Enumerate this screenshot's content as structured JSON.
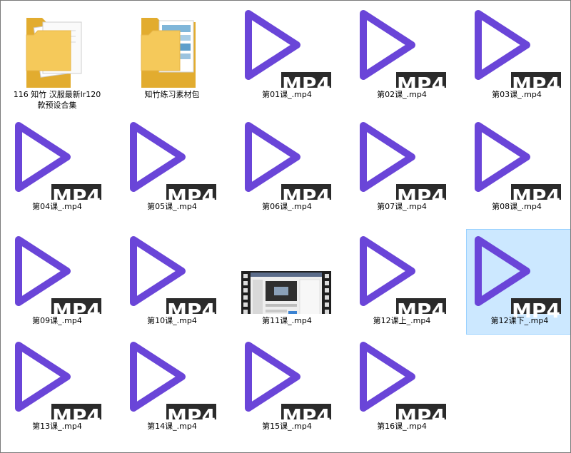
{
  "explorer": {
    "items": [
      {
        "label": "116  知竹 汉服最新lr120\n款预设合集",
        "kind": "folder",
        "icon": "folder-with-documents-icon",
        "selected": false
      },
      {
        "label": "知竹练习素材包",
        "kind": "folder",
        "icon": "folder-with-images-icon",
        "selected": false
      },
      {
        "label": "第01课_.mp4",
        "kind": "video",
        "icon": "mp4-play-icon",
        "badge": "MP4",
        "selected": false
      },
      {
        "label": "第02课_.mp4",
        "kind": "video",
        "icon": "mp4-play-icon",
        "badge": "MP4",
        "selected": false
      },
      {
        "label": "第03课_.mp4",
        "kind": "video",
        "icon": "mp4-play-icon",
        "badge": "MP4",
        "selected": false
      },
      {
        "label": "第04课_.mp4",
        "kind": "video",
        "icon": "mp4-play-icon",
        "badge": "MP4",
        "selected": false
      },
      {
        "label": "第05课_.mp4",
        "kind": "video",
        "icon": "mp4-play-icon",
        "badge": "MP4",
        "selected": false
      },
      {
        "label": "第06课_.mp4",
        "kind": "video",
        "icon": "mp4-play-icon",
        "badge": "MP4",
        "selected": false
      },
      {
        "label": "第07课_.mp4",
        "kind": "video",
        "icon": "mp4-play-icon",
        "badge": "MP4",
        "selected": false
      },
      {
        "label": "第08课_.mp4",
        "kind": "video",
        "icon": "mp4-play-icon",
        "badge": "MP4",
        "selected": false
      },
      {
        "label": "第09课_.mp4",
        "kind": "video",
        "icon": "mp4-play-icon",
        "badge": "MP4",
        "selected": false
      },
      {
        "label": "第10课_.mp4",
        "kind": "video",
        "icon": "mp4-play-icon",
        "badge": "MP4",
        "selected": false
      },
      {
        "label": "第11课_.mp4",
        "kind": "video-thumb",
        "icon": "video-thumbnail-filmstrip",
        "selected": false
      },
      {
        "label": "第12课上_.mp4",
        "kind": "video",
        "icon": "mp4-play-icon",
        "badge": "MP4",
        "selected": false
      },
      {
        "label": "第12课下_.mp4",
        "kind": "video",
        "icon": "mp4-play-icon",
        "badge": "MP4",
        "selected": true
      },
      {
        "label": "第13课_.mp4",
        "kind": "video",
        "icon": "mp4-play-icon",
        "badge": "MP4",
        "selected": false
      },
      {
        "label": "第14课_.mp4",
        "kind": "video",
        "icon": "mp4-play-icon",
        "badge": "MP4",
        "selected": false
      },
      {
        "label": "第15课_.mp4",
        "kind": "video",
        "icon": "mp4-play-icon",
        "badge": "MP4",
        "selected": false
      },
      {
        "label": "第16课_.mp4",
        "kind": "video",
        "icon": "mp4-play-icon",
        "badge": "MP4",
        "selected": false
      }
    ]
  },
  "colors": {
    "play": "#6a45d8",
    "badge_bg": "#2b2b2b",
    "badge_text": "#ffffff",
    "selection_bg": "#cce8ff",
    "selection_border": "#99d1ff",
    "folder": "#f5c95a",
    "folder_dark": "#e2ac2f"
  }
}
